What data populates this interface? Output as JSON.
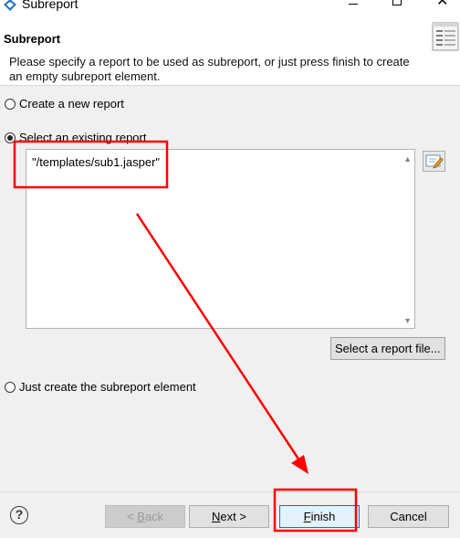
{
  "window": {
    "title": "Subreport"
  },
  "header": {
    "title": "Subreport",
    "description": "Please specify a report to be used as subreport, or just press finish to create an empty subreport element."
  },
  "options": {
    "create_new": "Create a new report",
    "select_existing": "Select an existing report",
    "just_create": "Just create the subreport element",
    "selected": "select_existing"
  },
  "report_expression": "\"/templates/sub1.jasper\"",
  "buttons": {
    "select_file": "Select a report file...",
    "back_prefix": "< ",
    "back_mnemonic": "B",
    "back_rest": "ack",
    "next_mnemonic": "N",
    "next_rest": "ext >",
    "finish_mnemonic": "F",
    "finish_rest": "inish",
    "cancel": "Cancel"
  },
  "icons": {
    "app": "eclipse-diamond-icon",
    "wizard": "report-list-icon",
    "browse": "edit-expression-icon",
    "help": "help-icon"
  },
  "colors": {
    "annotation": "#ff0000",
    "default_button_border": "#0078d7"
  }
}
